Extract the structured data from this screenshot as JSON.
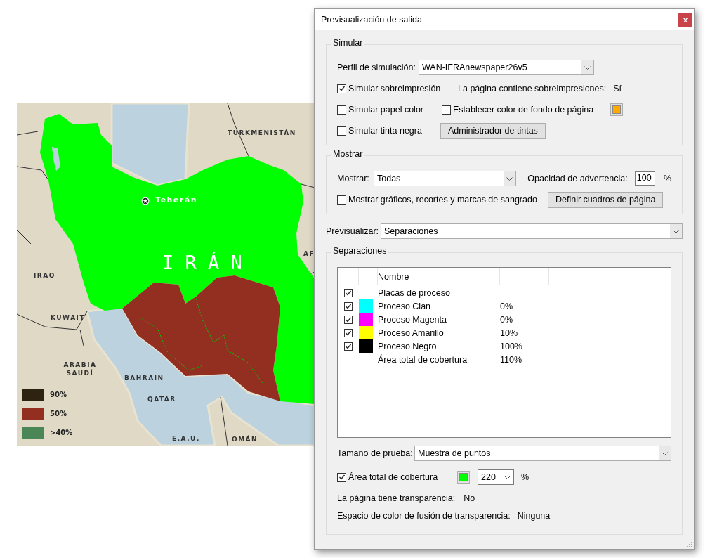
{
  "map": {
    "labels": [
      {
        "text": "TURKMENISTÁN",
        "kind": "country"
      },
      {
        "text": "Teherán",
        "kind": "capital"
      },
      {
        "text": "I R Á N",
        "kind": "main"
      },
      {
        "text": "AF",
        "kind": "country"
      },
      {
        "text": "IRAQ",
        "kind": "country"
      },
      {
        "text": "KUWAIT",
        "kind": "country"
      },
      {
        "text": "ARABIA SAUDÍ",
        "kind": "country"
      },
      {
        "text": "BAHRAIN",
        "kind": "country"
      },
      {
        "text": "QATAR",
        "kind": "country"
      },
      {
        "text": "E.A.U.",
        "kind": "country"
      },
      {
        "text": "OMÁN",
        "kind": "country"
      }
    ],
    "legend": [
      {
        "label": "90%",
        "color": "#2e2210"
      },
      {
        "label": "50%",
        "color": "#922f20"
      },
      {
        "label": ">40%",
        "color": "#4a8656"
      }
    ]
  },
  "dialog": {
    "title": "Previsualización de salida",
    "close": "x",
    "simular": {
      "title": "Simular",
      "profile_label": "Perfil de simulación:",
      "profile": "WAN-IFRAnewspaper26v5",
      "overprint": {
        "label": "Simular sobreimpresión",
        "checked": true
      },
      "overprint_info": {
        "label": "La página contiene sobreimpresiones:",
        "value": "Sí"
      },
      "paper": {
        "label": "Simular papel color",
        "checked": false
      },
      "background": {
        "label": "Establecer color de fondo de página",
        "checked": false,
        "color": "#ffaa00"
      },
      "black_ink": {
        "label": "Simular tinta negra",
        "checked": false
      },
      "ink_manager": "Administrador de tintas"
    },
    "mostrar": {
      "title": "Mostrar",
      "show_label": "Mostrar:",
      "show": "Todas",
      "opacity_label": "Opacidad de advertencia:",
      "opacity": "100",
      "percent": "%",
      "marks": {
        "label": "Mostrar gráficos, recortes y marcas de sangrado",
        "checked": false
      },
      "page_boxes": "Definir cuadros de página"
    },
    "preview_label": "Previsualizar:",
    "preview": "Separaciones",
    "separaciones": {
      "title": "Separaciones",
      "columns": [
        "Nombre"
      ],
      "rows": [
        {
          "kind": "group",
          "name": "Placas de proceso",
          "checked": true
        },
        {
          "kind": "plate",
          "name": "Proceso Cian",
          "checked": true,
          "color": "#00ffff",
          "value": "0%"
        },
        {
          "kind": "plate",
          "name": "Proceso Magenta",
          "checked": true,
          "color": "#ff00ff",
          "value": "0%"
        },
        {
          "kind": "plate",
          "name": "Proceso Amarillo",
          "checked": true,
          "color": "#ffff00",
          "value": "10%"
        },
        {
          "kind": "plate",
          "name": "Proceso Negro",
          "checked": true,
          "color": "#000000",
          "value": "100%"
        },
        {
          "kind": "total",
          "name": "Área total de cobertura",
          "value": "110%"
        }
      ],
      "sample_label": "Tamaño de prueba:",
      "sample": "Muestra de puntos",
      "coverage": {
        "label": "Área total de cobertura",
        "checked": true,
        "color": "#00ff00",
        "value": "220",
        "percent": "%"
      },
      "transparency": {
        "label": "La página tiene transparencia:",
        "value": "No"
      },
      "blend": {
        "label": "Espacio de color de fusión de transparencia:",
        "value": "Ninguna"
      }
    }
  }
}
